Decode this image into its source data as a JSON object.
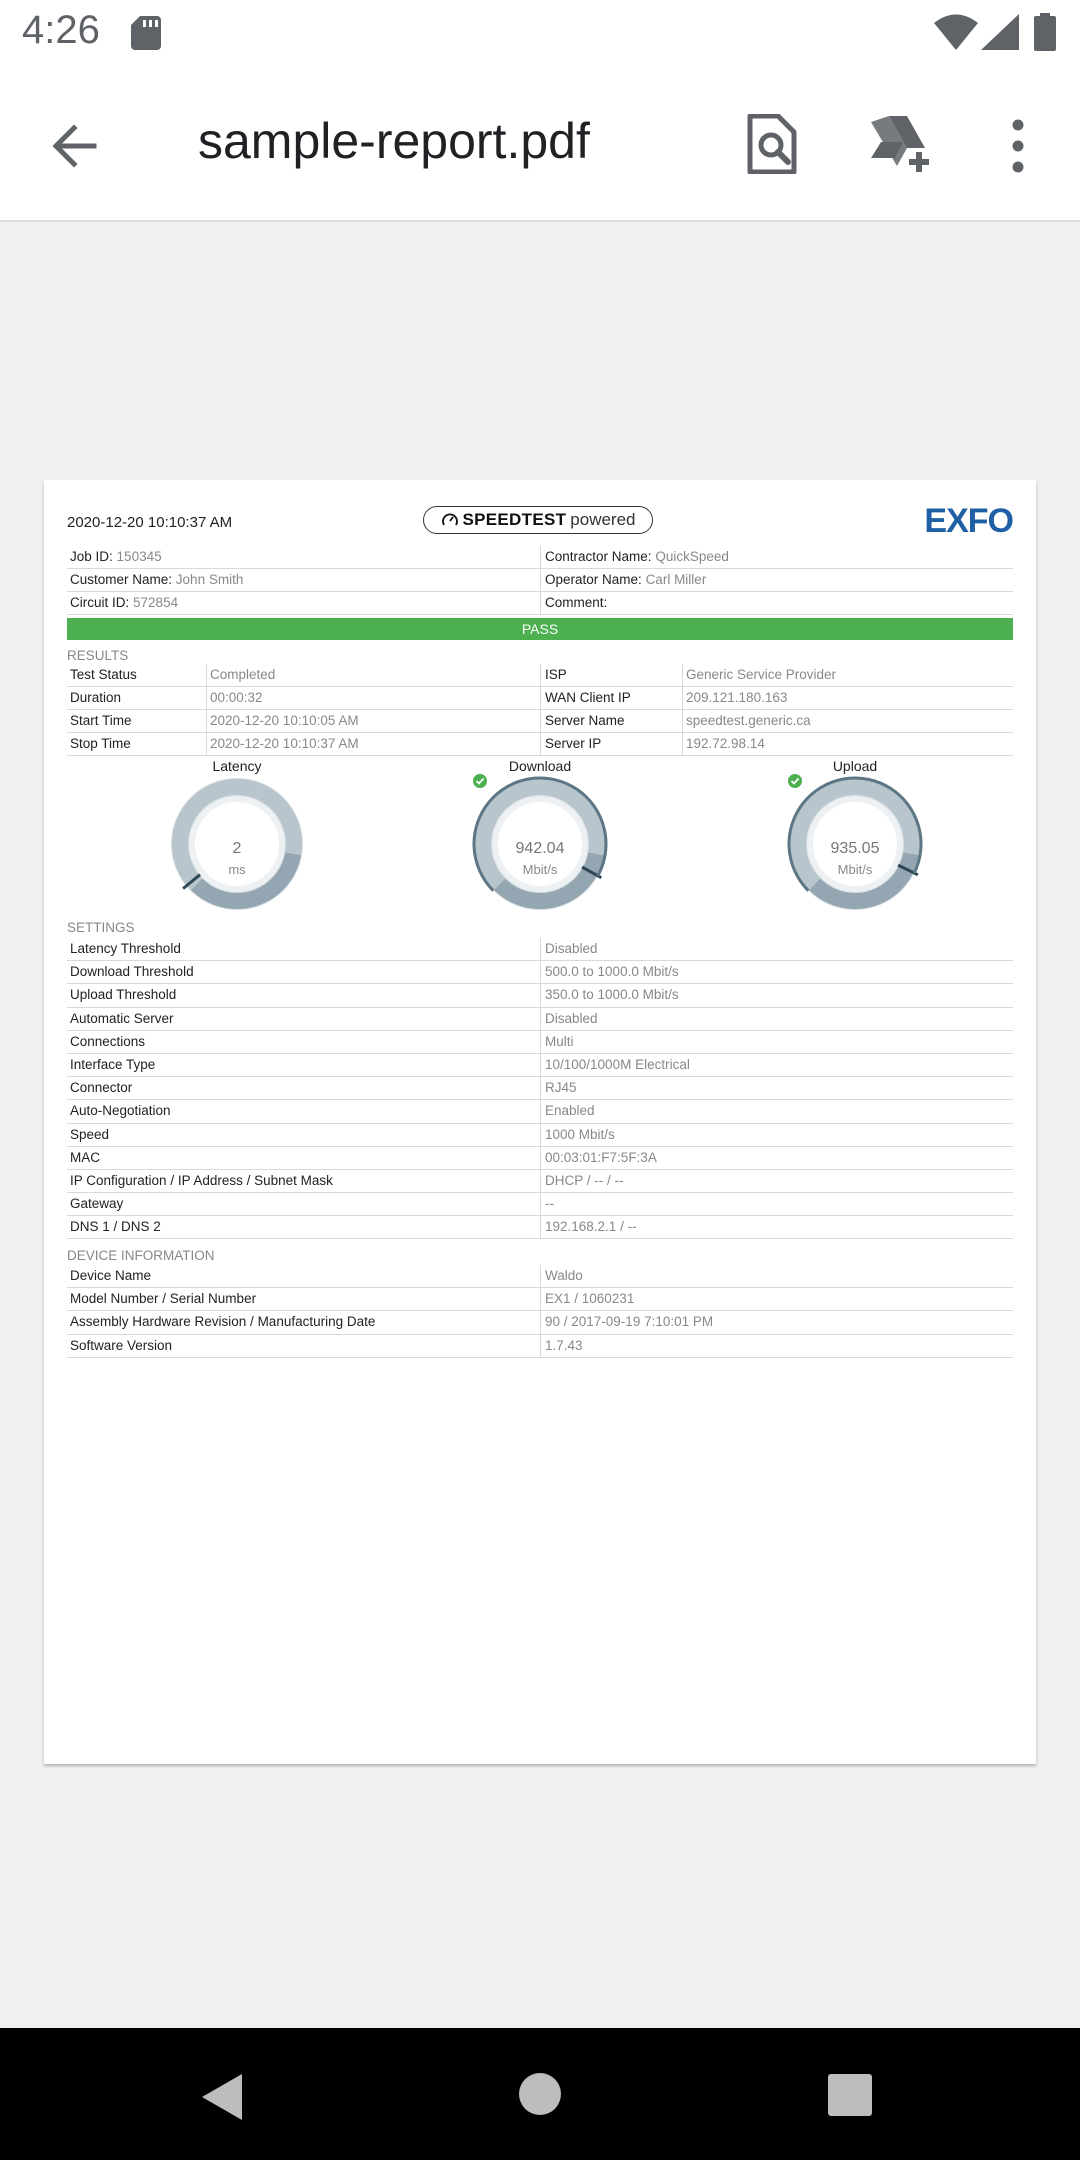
{
  "status_bar": {
    "time": "4:26"
  },
  "app_bar": {
    "title": "sample-report.pdf"
  },
  "report": {
    "date": "2020-12-20 10:10:37 AM",
    "badge": {
      "brand": "SPEEDTEST",
      "suffix": "powered"
    },
    "logo": "EXFO",
    "header_rows": [
      {
        "left_label": "Job ID:",
        "left_value": "150345",
        "right_label": "Contractor Name:",
        "right_value": "QuickSpeed"
      },
      {
        "left_label": "Customer Name:",
        "left_value": "John Smith",
        "right_label": "Operator Name:",
        "right_value": "Carl Miller"
      },
      {
        "left_label": "Circuit ID:",
        "left_value": "572854",
        "right_label": "Comment:",
        "right_value": ""
      }
    ],
    "status": "PASS",
    "status_color": "#4caf50",
    "results_title": "RESULTS",
    "results": [
      {
        "k1": "Test Status",
        "v1": "Completed",
        "k2": "ISP",
        "v2": "Generic Service Provider"
      },
      {
        "k1": "Duration",
        "v1": "00:00:32",
        "k2": "WAN Client IP",
        "v2": "209.121.180.163"
      },
      {
        "k1": "Start Time",
        "v1": "2020-12-20 10:10:05 AM",
        "k2": "Server Name",
        "v2": "speedtest.generic.ca"
      },
      {
        "k1": "Stop Time",
        "v1": "2020-12-20 10:10:37 AM",
        "k2": "Server IP",
        "v2": "192.72.98.14"
      }
    ],
    "gauges": [
      {
        "title": "Latency",
        "value": "2",
        "unit": "ms",
        "level": 0.02,
        "pass": false
      },
      {
        "title": "Download",
        "value": "942.04",
        "unit": "Mbit/s",
        "level": 0.94,
        "pass": true
      },
      {
        "title": "Upload",
        "value": "935.05",
        "unit": "Mbit/s",
        "level": 0.93,
        "pass": true
      }
    ],
    "settings_title": "SETTINGS",
    "settings": [
      {
        "label": "Latency Threshold",
        "value": "Disabled"
      },
      {
        "label": "Download Threshold",
        "value": "500.0 to 1000.0 Mbit/s"
      },
      {
        "label": "Upload Threshold",
        "value": "350.0 to 1000.0 Mbit/s"
      },
      {
        "label": "Automatic Server",
        "value": "Disabled"
      },
      {
        "label": "Connections",
        "value": "Multi"
      },
      {
        "label": "Interface Type",
        "value": "10/100/1000M Electrical"
      },
      {
        "label": "Connector",
        "value": "RJ45"
      },
      {
        "label": "Auto-Negotiation",
        "value": "Enabled"
      },
      {
        "label": "Speed",
        "value": "1000 Mbit/s"
      },
      {
        "label": "MAC",
        "value": "00:03:01:F7:5F:3A"
      },
      {
        "label": "IP Configuration / IP Address / Subnet Mask",
        "value": "DHCP / -- / --"
      },
      {
        "label": "Gateway",
        "value": "--"
      },
      {
        "label": "DNS 1 / DNS 2",
        "value": "192.168.2.1 / --"
      }
    ],
    "device_title": "DEVICE INFORMATION",
    "device": [
      {
        "label": "Device Name",
        "value": "Waldo"
      },
      {
        "label": "Model Number / Serial Number",
        "value": "EX1 / 1060231"
      },
      {
        "label": "Assembly Hardware Revision / Manufacturing Date",
        "value": "90 / 2017-09-19 7:10:01 PM"
      },
      {
        "label": "Software Version",
        "value": "1.7.43"
      }
    ]
  },
  "icons": {
    "back": "arrow-back-icon",
    "find": "find-in-document-icon",
    "drive": "add-to-drive-icon",
    "menu": "more-vert-icon",
    "sd": "sd-card-icon",
    "wifi": "wifi-icon",
    "signal": "cell-signal-icon",
    "battery": "battery-icon"
  }
}
